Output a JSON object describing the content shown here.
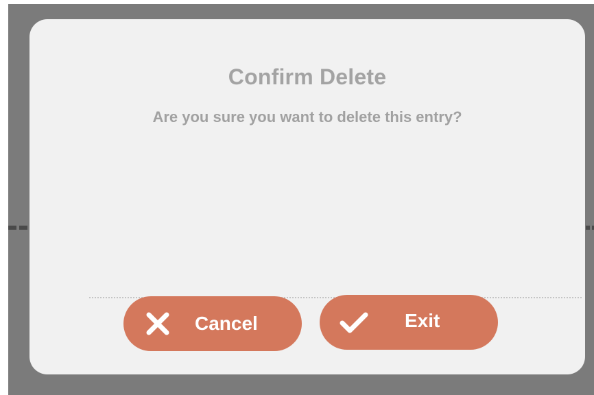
{
  "dialog": {
    "title": "Confirm Delete",
    "message": "Are you sure you want to delete this entry?"
  },
  "buttons": {
    "cancel": {
      "label": "Cancel",
      "icon": "close-icon"
    },
    "exit": {
      "label": "Exit",
      "icon": "checkmark-icon"
    }
  },
  "colors": {
    "button": "#d4785c",
    "dialog_bg": "#f1f1f1",
    "backdrop": "#7b7b7b",
    "text": "#a3a3a3"
  }
}
